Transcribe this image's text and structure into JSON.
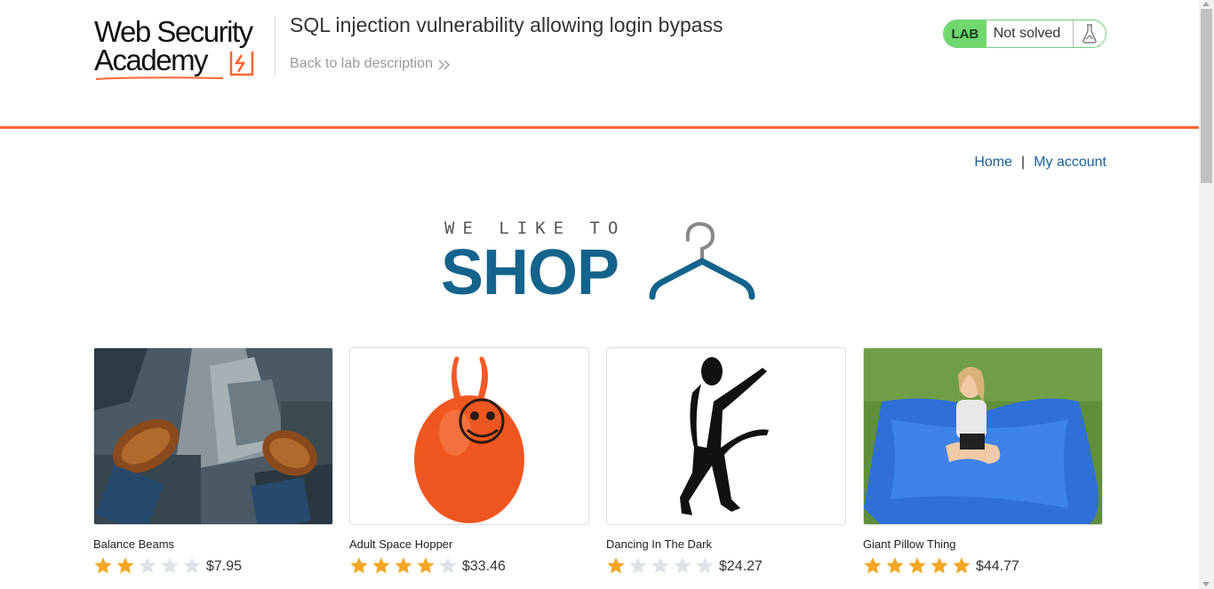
{
  "header": {
    "logo_line1": "Web Security",
    "logo_line2": "Academy",
    "lab_title": "SQL injection vulnerability allowing login bypass",
    "back_link": "Back to lab description",
    "lab_badge": "LAB",
    "lab_status": "Not solved",
    "accent_color": "#ff6633"
  },
  "nav": {
    "home": "Home",
    "separator": "|",
    "my_account": "My account"
  },
  "banner": {
    "tagline": "WE LIKE TO",
    "title": "SHOP"
  },
  "products": [
    {
      "name": "Balance Beams",
      "rating": 2,
      "price": "$7.95",
      "image": "shoes-over-city-image"
    },
    {
      "name": "Adult Space Hopper",
      "rating": 4,
      "price": "$33.46",
      "image": "space-hopper-image"
    },
    {
      "name": "Dancing In The Dark",
      "rating": 1,
      "price": "$24.27",
      "image": "dancer-silhouette-image"
    },
    {
      "name": "Giant Pillow Thing",
      "rating": 5,
      "price": "$44.77",
      "image": "giant-pillow-image"
    }
  ],
  "star_colors": {
    "filled": "#f5a623",
    "empty": "#dde3e8"
  }
}
